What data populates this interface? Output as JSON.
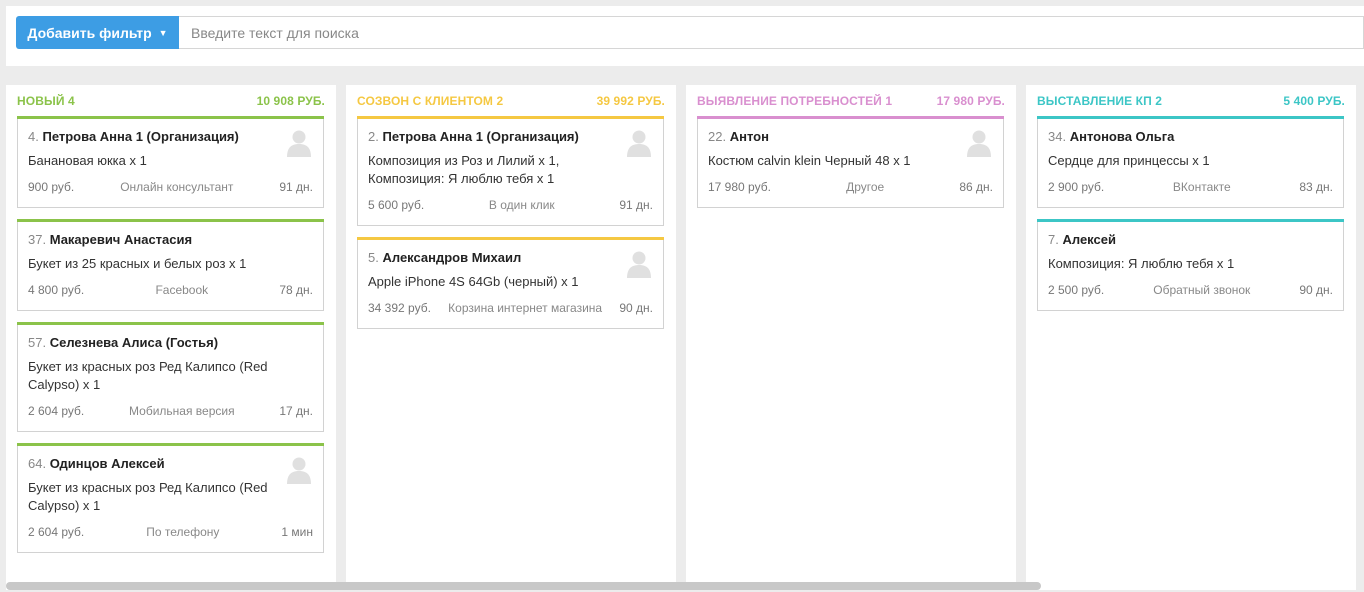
{
  "toolbar": {
    "filter_button_label": "Добавить фильтр",
    "search_placeholder": "Введите текст для поиска"
  },
  "colors": {
    "accent_button": "#3d9de4",
    "stage_new": "#8bc34a",
    "stage_call": "#f5c842",
    "stage_needs": "#d98fcf",
    "stage_offer": "#3cc6c6"
  },
  "columns": [
    {
      "title": "НОВЫЙ 4",
      "total": "10 908 РУБ.",
      "color": "#8bc34a",
      "cards": [
        {
          "num": "4.",
          "name": "Петрова Анна 1 (Организация)",
          "desc": "Банановая юкка x 1",
          "price": "900 руб.",
          "source": "Онлайн консультант",
          "age": "91 дн.",
          "avatar": true
        },
        {
          "num": "37.",
          "name": "Макаревич Анастасия",
          "desc": "Букет из 25 красных и белых роз x 1",
          "price": "4 800 руб.",
          "source": "Facebook",
          "age": "78 дн.",
          "avatar": false
        },
        {
          "num": "57.",
          "name": "Селезнева Алиса (Гостья)",
          "desc": "Букет из красных роз Ред Калипсо (Red Calypso) x 1",
          "price": "2 604 руб.",
          "source": "Мобильная версия",
          "age": "17 дн.",
          "avatar": false
        },
        {
          "num": "64.",
          "name": "Одинцов Алексей",
          "desc": "Букет из красных роз Ред Калипсо (Red Calypso) x 1",
          "price": "2 604 руб.",
          "source": "По телефону",
          "age": "1 мин",
          "avatar": true
        }
      ]
    },
    {
      "title": "СОЗВОН С КЛИЕНТОМ 2",
      "total": "39 992 РУБ.",
      "color": "#f5c842",
      "cards": [
        {
          "num": "2.",
          "name": "Петрова Анна 1 (Организация)",
          "desc": "Композиция из Роз и Лилий x 1, Композиция: Я люблю тебя x 1",
          "price": "5 600 руб.",
          "source": "В один клик",
          "age": "91 дн.",
          "avatar": true
        },
        {
          "num": "5.",
          "name": "Александров Михаил",
          "desc": "Apple iPhone 4S 64Gb (черный) x 1",
          "price": "34 392 руб.",
          "source": "Корзина интернет магазина",
          "age": "90 дн.",
          "avatar": true
        }
      ]
    },
    {
      "title": "ВЫЯВЛЕНИЕ ПОТРЕБНОСТЕЙ 1",
      "total": "17 980 РУБ.",
      "color": "#d98fcf",
      "cards": [
        {
          "num": "22.",
          "name": "Антон",
          "desc": "Костюм calvin klein Черный 48 x 1",
          "price": "17 980 руб.",
          "source": "Другое",
          "age": "86 дн.",
          "avatar": true
        }
      ]
    },
    {
      "title": "ВЫСТАВЛЕНИЕ КП 2",
      "total": "5 400 РУБ.",
      "color": "#3cc6c6",
      "cards": [
        {
          "num": "34.",
          "name": "Антонова Ольга",
          "desc": "Сердце для принцессы x 1",
          "price": "2 900 руб.",
          "source": "ВКонтакте",
          "age": "83 дн.",
          "avatar": false
        },
        {
          "num": "7.",
          "name": "Алексей",
          "desc": "Композиция: Я люблю тебя x 1",
          "price": "2 500 руб.",
          "source": "Обратный звонок",
          "age": "90 дн.",
          "avatar": false
        }
      ]
    }
  ]
}
